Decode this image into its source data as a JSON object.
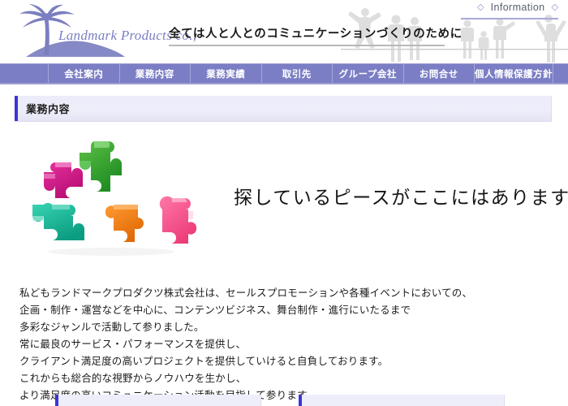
{
  "site": {
    "logo_text": "Landmark Products co.,",
    "logo_icon": "palm-tree-island-icon",
    "tagline": "全ては人と人とのコミュニケーションづくりのために"
  },
  "header": {
    "info_label": "Information",
    "diamond_left": "◇",
    "diamond_right": "◇",
    "silhouette_icon": "people-silhouettes-icon"
  },
  "nav": {
    "items": [
      {
        "label": "会社案内"
      },
      {
        "label": "業務内容"
      },
      {
        "label": "業務実績"
      },
      {
        "label": "取引先"
      },
      {
        "label": "グループ会社"
      },
      {
        "label": "お問合せ"
      },
      {
        "label": "個人情報保護方針"
      }
    ]
  },
  "page": {
    "section_title": "業務内容",
    "hero_headline": "探しているピースがここにはあります",
    "hero_image": "colorful-puzzle-pieces-image",
    "body_lines": [
      "私どもランドマークプロダクツ株式会社は、セールスプロモーションや各種イベントにおいての、",
      "企画・制作・運営などを中心に、コンテンツビジネス、舞台制作・進行にいたるまで",
      "多彩なジャンルで活動して参りました。",
      "常に最良のサービス・パフォーマンスを提供し、",
      "クライアント満足度の高いプロジェクトを提供していけると自負しております。",
      "これからも総合的な視野からノウハウを生かし、",
      "より満足度の高いコミュニケーション活動を目指して参ります。"
    ]
  },
  "bottom_sections": [
    {
      "label": ""
    },
    {
      "label": ""
    }
  ],
  "colors": {
    "nav_bg": "#7b7ec4",
    "nav_divider": "#a6a8d8",
    "accent_bar": "#3b35d8",
    "section_bg": "#eeeefb",
    "logo_purple": "#7b7fc0",
    "info_underline": "#a7a9d8",
    "puzzle_magenta": "#d6168c",
    "puzzle_green": "#3aa834",
    "puzzle_teal": "#16bfa0",
    "puzzle_orange": "#f58220",
    "puzzle_pink": "#f2558c"
  }
}
